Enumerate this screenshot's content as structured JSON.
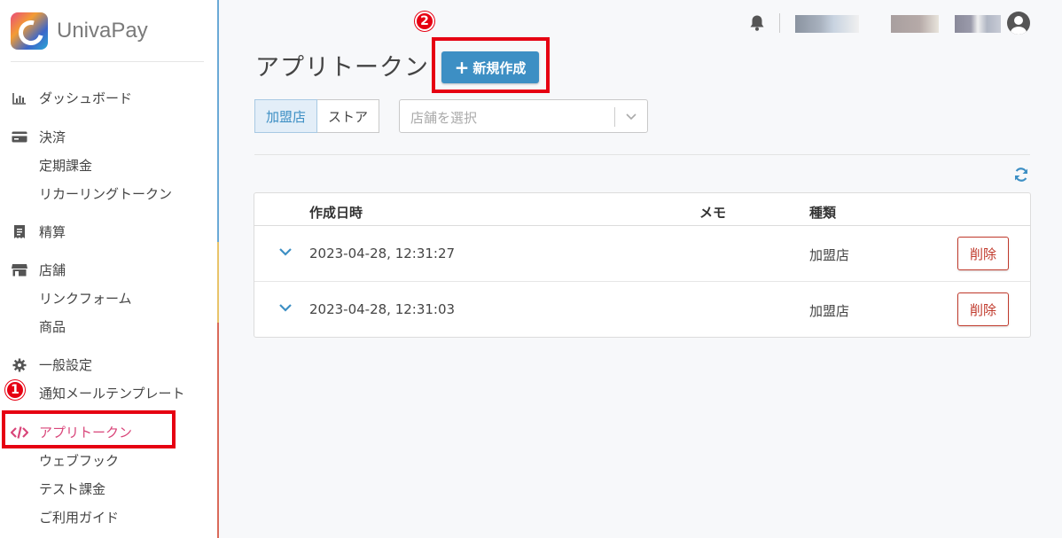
{
  "brand": {
    "name": "UnivaPay"
  },
  "sidebar": {
    "items": [
      {
        "label": "ダッシュボード",
        "icon": "chart-icon"
      },
      {
        "label": "決済",
        "icon": "credit-card-icon"
      },
      {
        "label": "定期課金"
      },
      {
        "label": "リカーリングトークン"
      },
      {
        "label": "精算",
        "icon": "receipt-icon"
      },
      {
        "label": "店舗",
        "icon": "store-icon"
      },
      {
        "label": "リンクフォーム"
      },
      {
        "label": "商品"
      },
      {
        "label": "一般設定",
        "icon": "gear-icon"
      },
      {
        "label": "通知メールテンプレート"
      },
      {
        "label": "アプリトークン",
        "icon": "code-icon",
        "active": true
      },
      {
        "label": "ウェブフック"
      },
      {
        "label": "テスト課金"
      },
      {
        "label": "ご利用ガイド"
      }
    ]
  },
  "annotations": {
    "step1": "1",
    "step2": "2"
  },
  "page": {
    "title": "アプリトークン",
    "new_button": "新規作成",
    "filter": {
      "merchant": "加盟店",
      "store": "ストア",
      "active": "merchant"
    },
    "store_select": {
      "placeholder": "店舗を選択"
    }
  },
  "table": {
    "headers": {
      "created": "作成日時",
      "memo": "メモ",
      "type": "種類"
    },
    "rows": [
      {
        "created": "2023-04-28, 12:31:27",
        "memo": "",
        "type": "加盟店",
        "action": "削除"
      },
      {
        "created": "2023-04-28, 12:31:03",
        "memo": "",
        "type": "加盟店",
        "action": "削除"
      }
    ]
  },
  "colors": {
    "accent": "#3d8fc4",
    "active_nav": "#d9467a",
    "danger": "#c0392b",
    "annotation": "#e60012"
  }
}
